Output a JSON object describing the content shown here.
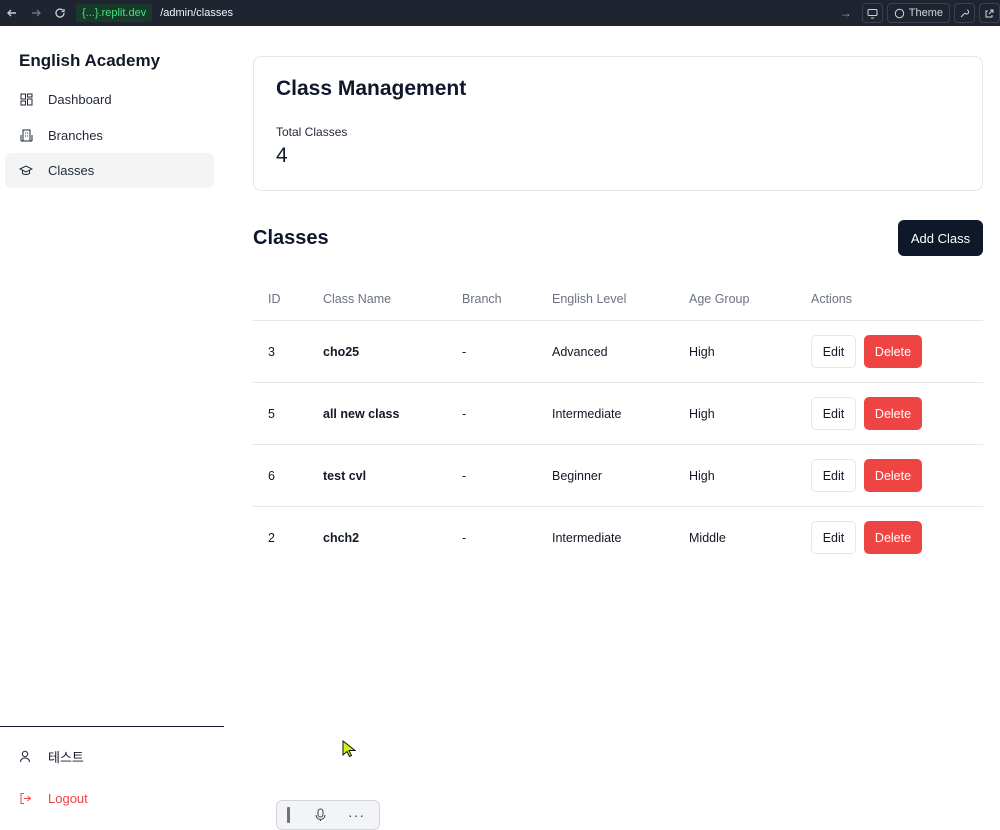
{
  "browser": {
    "domain": "{...}.replit.dev",
    "path": "/admin/classes",
    "theme_label": "Theme"
  },
  "sidebar": {
    "brand": "English Academy",
    "items": [
      {
        "label": "Dashboard",
        "icon": "dashboard-icon"
      },
      {
        "label": "Branches",
        "icon": "building-icon"
      },
      {
        "label": "Classes",
        "icon": "graduation-cap-icon",
        "active": true
      }
    ],
    "user_name": "테스트",
    "logout_label": "Logout"
  },
  "summary": {
    "title": "Class Management",
    "stat_label": "Total Classes",
    "stat_value": "4"
  },
  "classes": {
    "title": "Classes",
    "add_button": "Add Class",
    "columns": [
      "ID",
      "Class Name",
      "Branch",
      "English Level",
      "Age Group",
      "Actions"
    ],
    "rows": [
      {
        "id": "3",
        "name": "cho25",
        "branch": "-",
        "level": "Advanced",
        "age": "High"
      },
      {
        "id": "5",
        "name": "all new class",
        "branch": "-",
        "level": "Intermediate",
        "age": "High"
      },
      {
        "id": "6",
        "name": "test cvl",
        "branch": "-",
        "level": "Beginner",
        "age": "High"
      },
      {
        "id": "2",
        "name": "chch2",
        "branch": "-",
        "level": "Intermediate",
        "age": "Middle"
      }
    ],
    "edit_label": "Edit",
    "delete_label": "Delete"
  },
  "colors": {
    "primary": "#0f172a",
    "danger": "#ef4444",
    "active_bg": "#f4f4f5"
  }
}
